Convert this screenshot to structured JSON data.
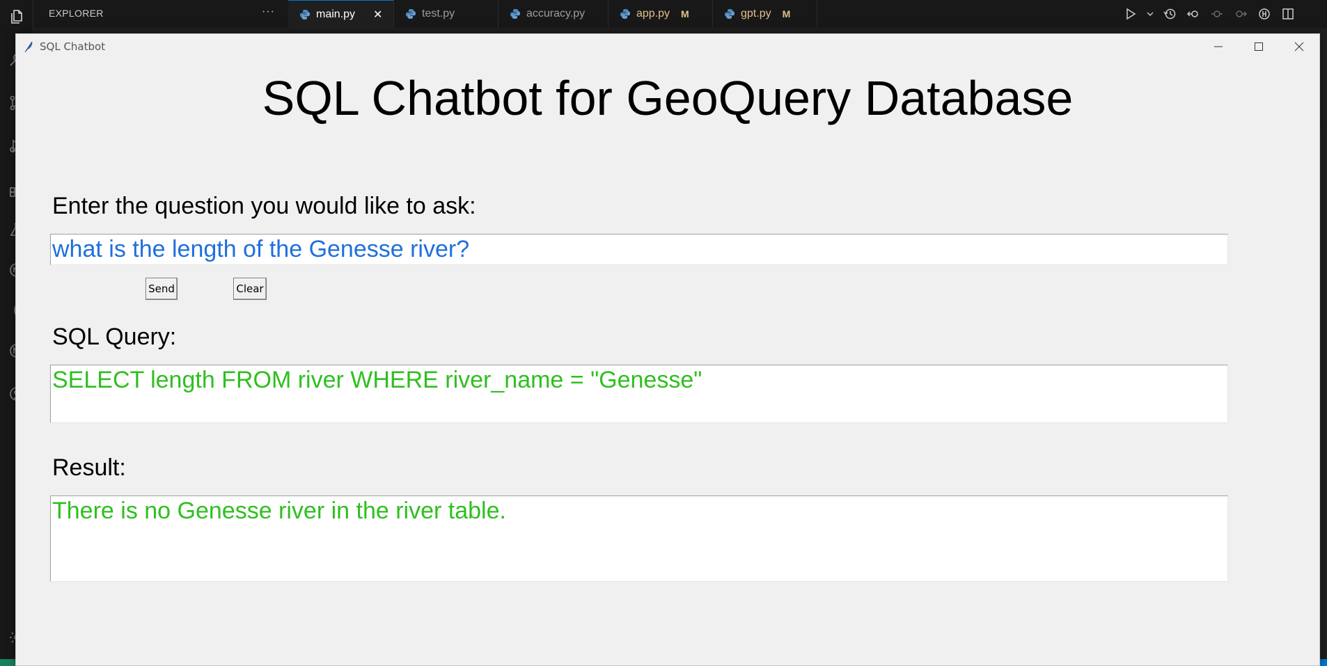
{
  "vscode": {
    "explorer_title": "EXPLORER",
    "explorer_more": "···",
    "tabs": [
      {
        "label": "main.py",
        "active": true,
        "badge": "",
        "close": "✕"
      },
      {
        "label": "test.py",
        "active": false,
        "badge": ""
      },
      {
        "label": "accuracy.py",
        "active": false,
        "badge": ""
      },
      {
        "label": "app.py",
        "active": false,
        "badge": "M"
      },
      {
        "label": "gpt.py",
        "active": false,
        "badge": "M"
      }
    ],
    "colors": {
      "accent": "#0078d4",
      "modified": "#e2c08d",
      "python_icon": "#4b8bbe"
    }
  },
  "window": {
    "title": "SQL Chatbot",
    "icon": "feather-icon"
  },
  "app": {
    "heading": "SQL Chatbot for GeoQuery Database",
    "question_label": "Enter the question you would like to ask:",
    "question_value": "what is the length of the Genesse river?",
    "send_label": "Send",
    "clear_label": "Clear",
    "sql_label": "SQL Query:",
    "sql_value": "SELECT length FROM river WHERE river_name = \"Genesse\"",
    "result_label": "Result:",
    "result_value": "There is no Genesse river in the river table.",
    "colors": {
      "question_text": "#1f6fdb",
      "output_text": "#2fbf1f"
    }
  }
}
